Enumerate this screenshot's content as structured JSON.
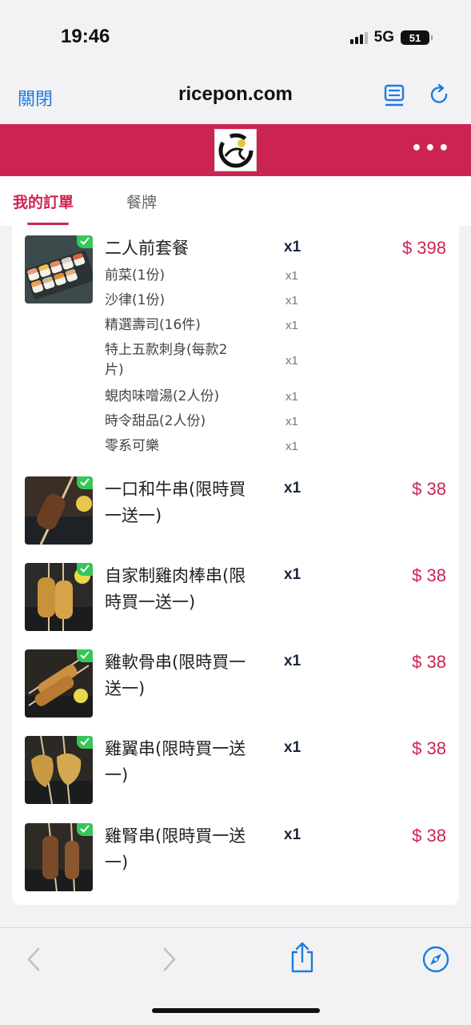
{
  "status_bar": {
    "time": "19:46",
    "network": "5G",
    "battery": "51"
  },
  "nav": {
    "close_label": "關閉",
    "url": "ricepon.com"
  },
  "tabs": [
    {
      "label": "我的訂單"
    },
    {
      "label": "餐牌"
    }
  ],
  "order": {
    "items": [
      {
        "name": "二人前套餐",
        "qty": "x1",
        "price": "$ 398",
        "sub_items": [
          {
            "name": "前菜(1份)",
            "qty": "x1"
          },
          {
            "name": "沙律(1份)",
            "qty": "x1"
          },
          {
            "name": "精選壽司(16件)",
            "qty": "x1"
          },
          {
            "name": "特上五款刺身(每款2片)",
            "qty": "x1"
          },
          {
            "name": "蜆肉味噌湯(2人份)",
            "qty": "x1"
          },
          {
            "name": "時令甜品(2人份)",
            "qty": "x1"
          },
          {
            "name": "零系可樂",
            "qty": "x1"
          }
        ]
      },
      {
        "name": "一口和牛串(限時買一送一)",
        "qty": "x1",
        "price": "$ 38"
      },
      {
        "name": "自家制雞肉棒串(限時買一送一)",
        "qty": "x1",
        "price": "$ 38"
      },
      {
        "name": "雞軟骨串(限時買一送一)",
        "qty": "x1",
        "price": "$ 38"
      },
      {
        "name": "雞翼串(限時買一送一)",
        "qty": "x1",
        "price": "$ 38"
      },
      {
        "name": "雞腎串(限時買一送一)",
        "qty": "x1",
        "price": "$ 38"
      }
    ]
  },
  "colors": {
    "brand": "#cc2452",
    "link": "#1d7be0",
    "check": "#35c759"
  },
  "icons": {
    "nav": [
      "reader-icon",
      "reload-icon"
    ],
    "toolbar": [
      "back-icon",
      "forward-icon",
      "share-icon",
      "compass-icon"
    ],
    "more": "more-icon"
  }
}
